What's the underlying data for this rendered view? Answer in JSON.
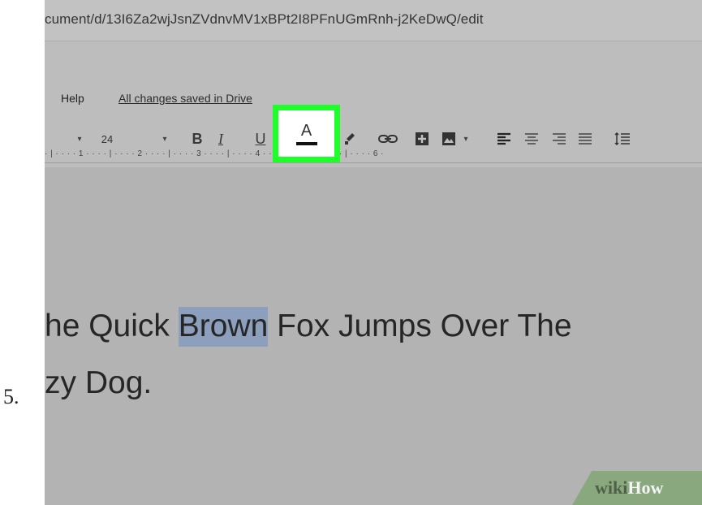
{
  "step": {
    "number": "5."
  },
  "browser": {
    "url": "cument/d/13I6Za2wjJsnZVdnvMV1xBPt2I8PFnUGmRnh-j2KeDwQ/edit"
  },
  "menu": {
    "help": "Help",
    "saved_status": "All changes saved in Drive"
  },
  "toolbar": {
    "font_dropdown_caret": "▾",
    "font_size": "24",
    "font_size_caret": "▾",
    "bold": "B",
    "italic": "I",
    "underline": "U",
    "text_color": "A",
    "image_caret": "▾"
  },
  "ruler": {
    "marks": "· | · · · · 1 · · · · | · · · · 2 · · · · | · · · · 3 · · · · | · · · · 4 · · · · | · · · · 5 · · · · | · · · · 6 ·"
  },
  "document": {
    "line1_before": "he Quick ",
    "line1_selected": "Brown",
    "line1_after": " Fox Jumps Over The",
    "line2": "zy Dog."
  },
  "watermark": {
    "wiki": "wiki",
    "how": "How"
  },
  "colors": {
    "highlight": "#1eff2a",
    "selection": "#8c9fbd",
    "background": "#b3b3b3"
  },
  "icons": [
    "paint-format-icon",
    "link-icon",
    "insert-comment-icon",
    "insert-image-icon",
    "align-left-icon",
    "align-center-icon",
    "align-right-icon",
    "align-justify-icon",
    "line-spacing-icon"
  ]
}
